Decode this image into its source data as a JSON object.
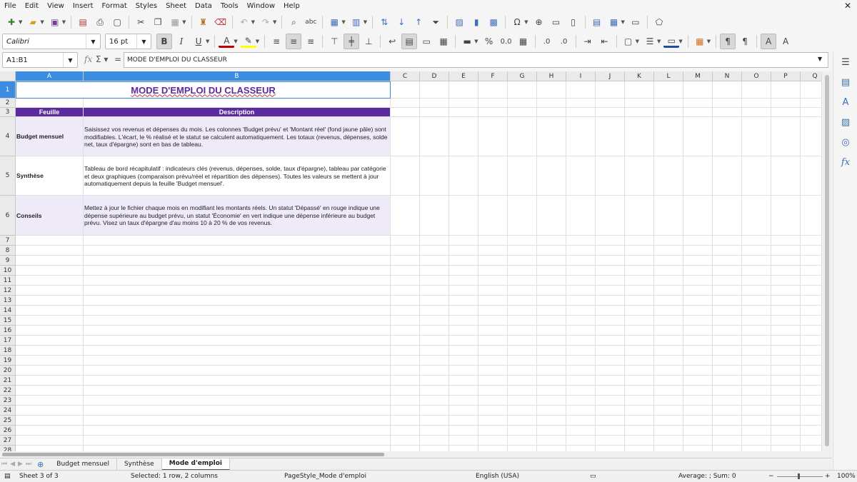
{
  "menu": [
    "File",
    "Edit",
    "View",
    "Insert",
    "Format",
    "Styles",
    "Sheet",
    "Data",
    "Tools",
    "Window",
    "Help"
  ],
  "font": {
    "name": "Calibri",
    "size": "16 pt"
  },
  "namebox": "A1:B1",
  "formula": "MODE D'EMPLOI DU CLASSEUR",
  "columns": [
    "A",
    "B",
    "C",
    "D",
    "E",
    "F",
    "G",
    "H",
    "I",
    "J",
    "K",
    "L",
    "M",
    "N",
    "O",
    "P",
    "Q"
  ],
  "rows": [
    "1",
    "2",
    "3",
    "4",
    "5",
    "6",
    "7",
    "8",
    "9",
    "10",
    "11",
    "12",
    "13",
    "14",
    "15",
    "16",
    "17",
    "18",
    "19",
    "20",
    "21",
    "22",
    "23",
    "24",
    "25",
    "26",
    "27",
    "28"
  ],
  "sheet": {
    "title": "MODE D'EMPLOI DU CLASSEUR",
    "header_feuille": "Feuille",
    "header_description": "Description",
    "entries": [
      {
        "label": "Budget mensuel",
        "text": "Saisissez vos revenus et dépenses du mois. Les colonnes 'Budget prévu' et 'Montant réel' (fond jaune pâle) sont modifiables. L'écart, le % réalisé et le statut se calculent automatiquement. Les totaux (revenus, dépenses, solde net, taux d'épargne) sont en bas de tableau."
      },
      {
        "label": "Synthèse",
        "text": "Tableau de bord récapitulatif : indicateurs clés (revenus, dépenses, solde, taux d'épargne), tableau par catégorie et deux graphiques (comparaison prévu/réel et répartition des dépenses). Toutes les valeurs se mettent à jour automatiquement depuis la feuille 'Budget mensuel'."
      },
      {
        "label": "Conseils",
        "text": "Mettez à jour le fichier chaque mois en modifiant les montants réels. Un statut 'Dépassé' en rouge indique une dépense supérieure au budget prévu, un statut 'Économie' en vert indique une dépense inférieure au budget prévu. Visez un taux d'épargne d'au moins 10 à 20 % de vos revenus."
      }
    ]
  },
  "tabs": [
    "Budget mensuel",
    "Synthèse",
    "Mode d'emploi"
  ],
  "active_tab": "Mode d'emploi",
  "status": {
    "sheet": "Sheet 3 of 3",
    "selection": "Selected: 1 row, 2 columns",
    "pagestyle": "PageStyle_Mode d'emploi",
    "language": "English (USA)",
    "summary": "Average: ; Sum: 0",
    "zoom": "100%"
  },
  "colors": {
    "accent_purple": "#5b2a9e",
    "lavender": "#efeaf8",
    "selection_blue": "#3c8de0"
  }
}
